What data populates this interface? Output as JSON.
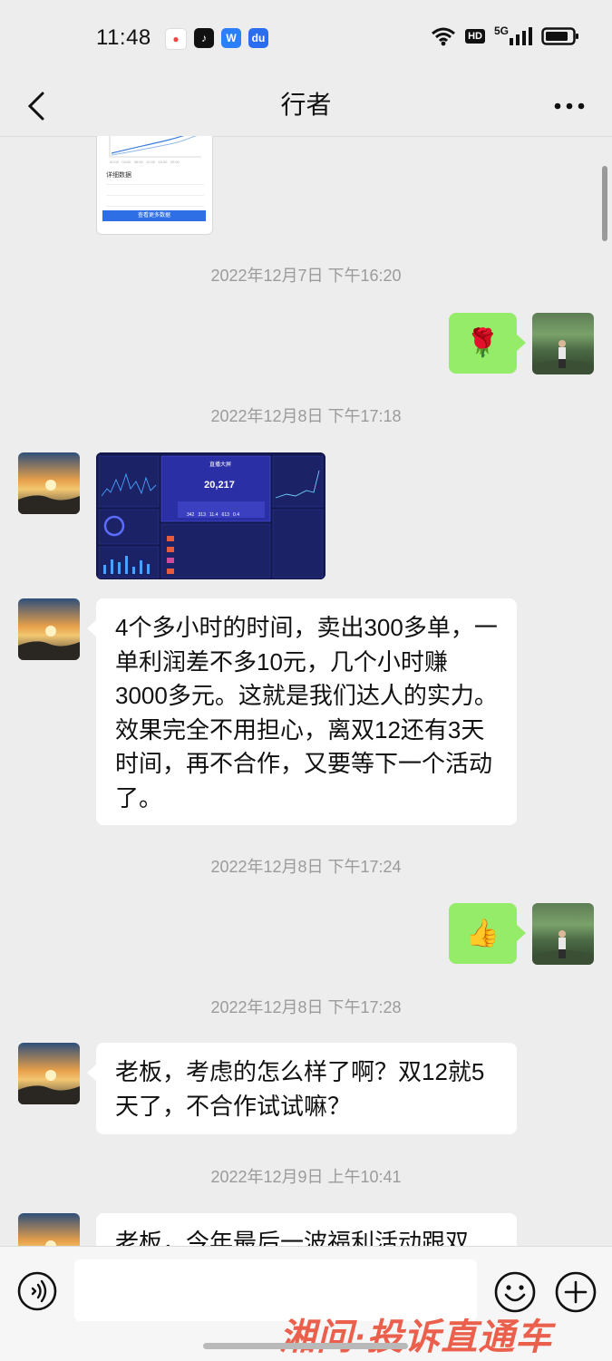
{
  "status_bar": {
    "time": "11:48",
    "hd_label": "HD",
    "network": "5G"
  },
  "header": {
    "title": "行者"
  },
  "chat": {
    "timestamps": [
      "2022年12月7日 下午16:20",
      "2022年12月8日 下午17:18",
      "2022年12月8日 下午17:24",
      "2022年12月8日 下午17:28",
      "2022年12月9日 上午10:41"
    ],
    "messages": [
      "4个多小时的时间，卖出300多单，一单利润差不多10元，几个小时赚3000多元。这就是我们达人的实力。效果完全不用担心，离双12还有3天时间，再不合作，又要等下一个活动了。",
      "老板，考虑的怎么样了啊？双12就5天了，不合作试试嘛？",
      "老板，今年最后一波福利活动跟双"
    ],
    "sent_emojis": [
      "🌹",
      "👍"
    ],
    "top_screenshot": {
      "section_title": "详细数据",
      "button_label": "查看更多数据"
    },
    "dashboard_image": {
      "headline_number": "20,217",
      "title": "直播大屏"
    }
  },
  "input": {
    "placeholder": ""
  },
  "watermark": "湘问·投诉直通车",
  "colors": {
    "background": "#ededed",
    "sent_bubble": "#95ec69",
    "received_bubble": "#ffffff",
    "timestamp": "#9b9b9b"
  }
}
